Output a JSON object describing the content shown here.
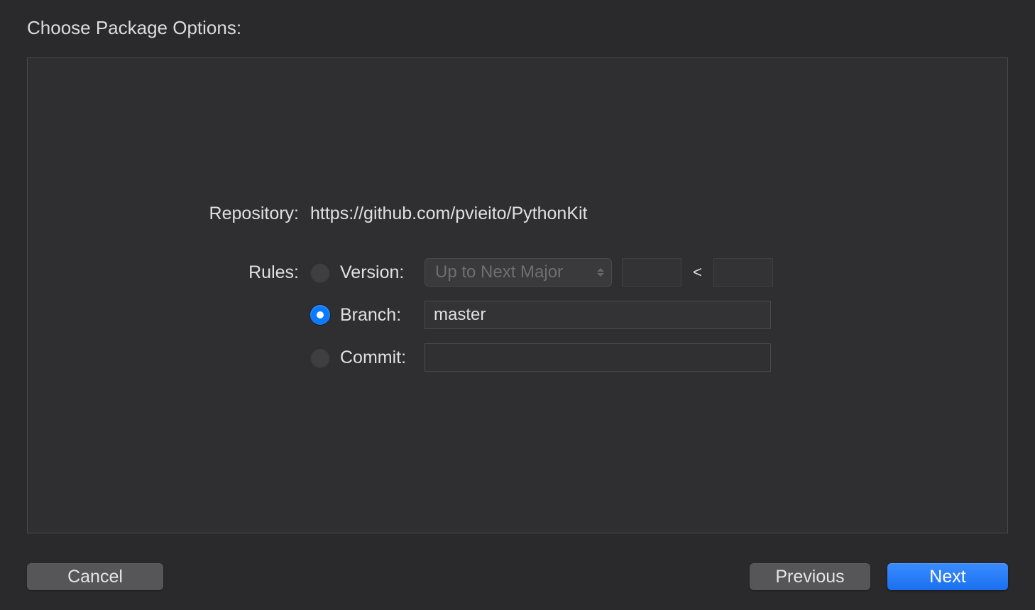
{
  "title": "Choose Package Options:",
  "repository": {
    "label": "Repository:",
    "value": "https://github.com/pvieito/PythonKit"
  },
  "rules": {
    "label": "Rules:",
    "options": {
      "version": {
        "label": "Version:",
        "selected": false,
        "dropdown": "Up to Next Major",
        "lowerBound": "",
        "separator": "<",
        "upperBound": ""
      },
      "branch": {
        "label": "Branch:",
        "selected": true,
        "value": "master"
      },
      "commit": {
        "label": "Commit:",
        "selected": false,
        "value": ""
      }
    }
  },
  "buttons": {
    "cancel": "Cancel",
    "previous": "Previous",
    "next": "Next"
  }
}
